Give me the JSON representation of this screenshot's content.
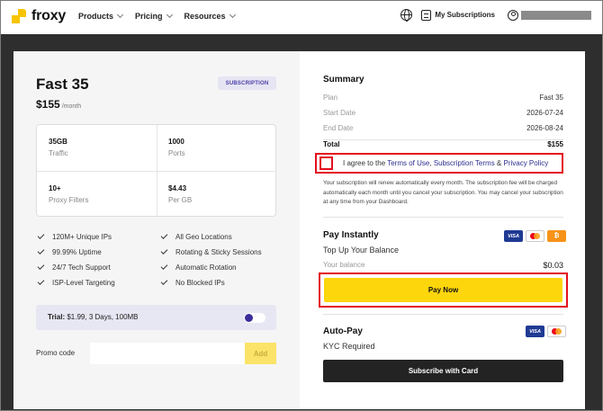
{
  "nav": {
    "logo": "froxy",
    "links": [
      {
        "label": "Products"
      },
      {
        "label": "Pricing"
      },
      {
        "label": "Resources"
      }
    ],
    "subscriptions_label": "My Subscriptions"
  },
  "plan": {
    "name": "Fast 35",
    "badge": "SUBSCRIPTION",
    "price": "$155",
    "price_unit": "/month",
    "stats": [
      {
        "value": "35GB",
        "label": "Traffic"
      },
      {
        "value": "1000",
        "label": "Ports"
      },
      {
        "value": "10+",
        "label": "Proxy Filters"
      },
      {
        "value": "$4.43",
        "label": "Per GB"
      }
    ],
    "features": [
      "120M+ Unique IPs",
      "All Geo Locations",
      "99.99% Uptime",
      "Rotating & Sticky Sessions",
      "24/7 Tech Support",
      "Automatic Rotation",
      "ISP-Level Targeting",
      "No Blocked IPs"
    ],
    "trial_label": "Trial:",
    "trial_text": "$1.99, 3 Days, 100MB",
    "promo_label": "Promo code",
    "promo_placeholder": "",
    "promo_button": "Add"
  },
  "summary": {
    "title": "Summary",
    "rows": [
      {
        "label": "Plan",
        "value": "Fast 35"
      },
      {
        "label": "Start Date",
        "value": "2026-07-24"
      },
      {
        "label": "End Date",
        "value": "2026-08-24"
      },
      {
        "label": "Total",
        "value": "$155"
      }
    ],
    "agree_prefix": "I agree to the ",
    "terms_link": "Terms of Use",
    "comma": ", ",
    "sub_terms_link": "Subscription Terms",
    "amp": " & ",
    "privacy_link": "Privacy Policy",
    "renew_text": "Your subscription will renew automatically every month. The subscription fee will be charged automatically each month until you cancel your subscription. You may cancel your subscription at any time from your Dashboard."
  },
  "pay_instantly": {
    "title": "Pay Instantly",
    "topup": "Top Up Your Balance",
    "balance_label": "Your balance",
    "balance_value": "$0.03",
    "button": "Pay Now",
    "visa": "VISA",
    "btc": "₿"
  },
  "auto_pay": {
    "title": "Auto-Pay",
    "kyc": "KYC Required",
    "button": "Subscribe with Card",
    "visa": "VISA"
  },
  "colors": {
    "accent_yellow": "#fdd60b",
    "highlight_red": "#e3101d",
    "badge_purple": "#4a3fa8",
    "dark_bg": "#2e2e2e"
  }
}
